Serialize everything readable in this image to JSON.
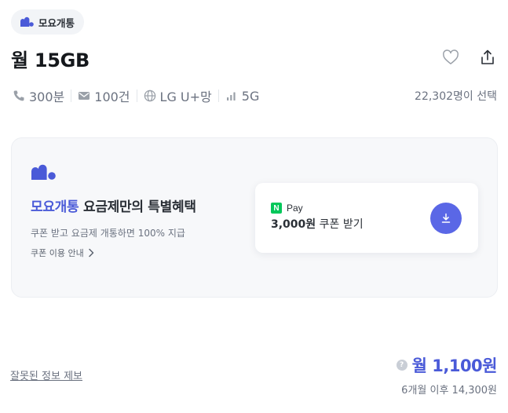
{
  "brand": {
    "name": "모요개통",
    "accent": "#4a5ad8"
  },
  "plan": {
    "title": "월 15GB"
  },
  "actions": {
    "like_icon": "heart-icon",
    "share_icon": "share-icon"
  },
  "specs": [
    {
      "icon": "phone-icon",
      "value": "300분"
    },
    {
      "icon": "mail-icon",
      "value": "100건"
    },
    {
      "icon": "globe-icon",
      "value": "LG U+망"
    },
    {
      "icon": "signal-icon",
      "value": "5G"
    }
  ],
  "selected_count": "22,302명이 선택",
  "promo": {
    "headline_brand": "모요개통",
    "headline_rest": " 요금제만의 특별혜택",
    "description": "쿠폰 받고 요금제 개통하면 100% 지급",
    "link_label": "쿠폰 이용 안내",
    "coupon": {
      "provider_mark": "N",
      "provider_label": "Pay",
      "amount": "3,000원",
      "label": " 쿠폰 받기"
    }
  },
  "report_link": "잘못된 정보 제보",
  "price": {
    "current": "월 1,100원",
    "after": "6개월 이후 14,300원",
    "help_symbol": "?"
  }
}
